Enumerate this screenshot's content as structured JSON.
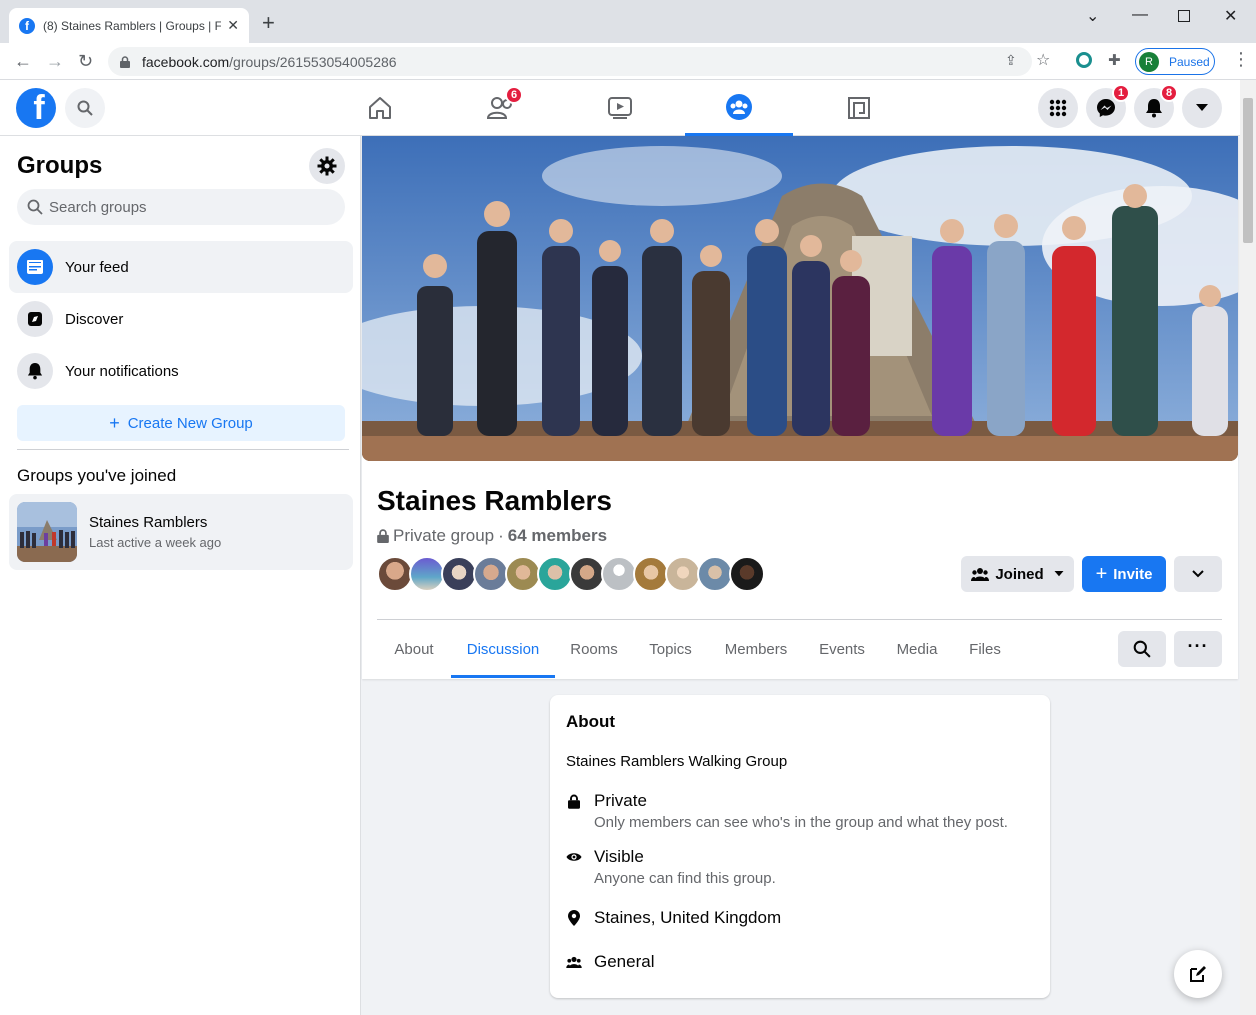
{
  "browser": {
    "tab_title": "(8) Staines Ramblers | Groups | Fa",
    "url_host": "facebook.com",
    "url_path": "/groups/261553054005286",
    "profile_initial": "R",
    "profile_status": "Paused"
  },
  "topbar": {
    "friends_badge": "6",
    "messenger_badge": "1",
    "notifications_badge": "8",
    "accent": "#1877f2"
  },
  "sidebar": {
    "title": "Groups",
    "search_placeholder": "Search groups",
    "items": [
      {
        "label": "Your feed",
        "icon": "feed-icon"
      },
      {
        "label": "Discover",
        "icon": "discover-icon"
      },
      {
        "label": "Your notifications",
        "icon": "bell-icon"
      }
    ],
    "create_label": "Create New Group",
    "joined_heading": "Groups you've joined",
    "joined_groups": [
      {
        "name": "Staines Ramblers",
        "sub": "Last active a week ago"
      }
    ]
  },
  "group": {
    "name": "Staines Ramblers",
    "privacy": "Private group",
    "members": "64 members",
    "joined_label": "Joined",
    "invite_label": "Invite",
    "tabs": [
      "About",
      "Discussion",
      "Rooms",
      "Topics",
      "Members",
      "Events",
      "Media",
      "Files"
    ],
    "active_tab": "Discussion"
  },
  "about": {
    "heading": "About",
    "description": "Staines Ramblers Walking Group",
    "privacy_title": "Private",
    "privacy_desc": "Only members can see who's in the group and what they post.",
    "visible_title": "Visible",
    "visible_desc": "Anyone can find this group.",
    "location": "Staines, United Kingdom",
    "category": "General"
  }
}
